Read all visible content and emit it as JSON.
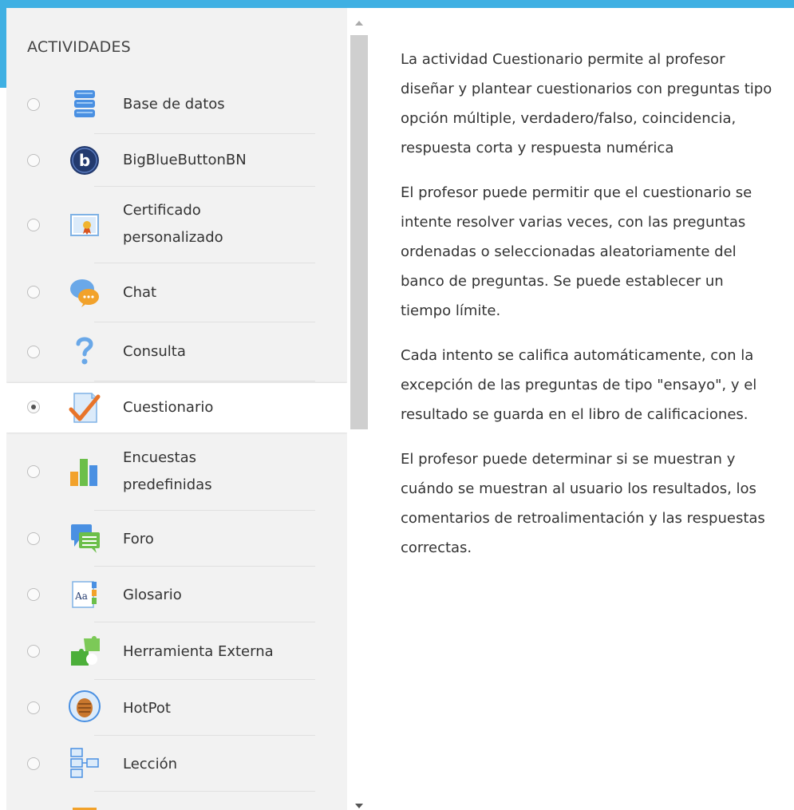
{
  "activities": {
    "heading": "ACTIVIDADES",
    "items": [
      {
        "label": "Base de datos",
        "icon": "database-icon",
        "selected": false
      },
      {
        "label": "BigBlueButtonBN",
        "icon": "bigbluebutton-icon",
        "selected": false
      },
      {
        "label": "Certificado\npersonalizado",
        "icon": "certificate-icon",
        "selected": false
      },
      {
        "label": "Chat",
        "icon": "chat-icon",
        "selected": false
      },
      {
        "label": "Consulta",
        "icon": "question-mark-icon",
        "selected": false
      },
      {
        "label": "Cuestionario",
        "icon": "quiz-checkmark-icon",
        "selected": true
      },
      {
        "label": "Encuestas\npredefinidas",
        "icon": "bar-chart-icon",
        "selected": false
      },
      {
        "label": "Foro",
        "icon": "forum-icon",
        "selected": false
      },
      {
        "label": "Glosario",
        "icon": "glossary-icon",
        "selected": false
      },
      {
        "label": "Herramienta Externa",
        "icon": "puzzle-icon",
        "selected": false
      },
      {
        "label": "HotPot",
        "icon": "hotpot-icon",
        "selected": false
      },
      {
        "label": "Lección",
        "icon": "lesson-icon",
        "selected": false
      }
    ]
  },
  "description": {
    "paragraphs": [
      "La actividad Cuestionario permite al profesor diseñar y plantear cuestionarios con preguntas tipo opción múltiple, verdadero/falso, coincidencia, respuesta corta y respuesta numérica",
      "El profesor puede permitir que el cuestionario se intente resolver varias veces, con las preguntas ordenadas o seleccionadas aleatoriamente del banco de preguntas. Se puede establecer un tiempo límite.",
      "Cada intento se califica automáticamente, con la excepción de las preguntas de tipo \"ensayo\", y el resultado se guarda en el libro de calificaciones.",
      "El profesor puede determinar si se muestran y cuándo se muestran al usuario los resultados, los comentarios de retroalimentación y las respuestas correctas."
    ]
  },
  "colors": {
    "accent": "#3fb0e3",
    "panel_bg": "#f2f2f2",
    "check_orange": "#e8742a"
  }
}
